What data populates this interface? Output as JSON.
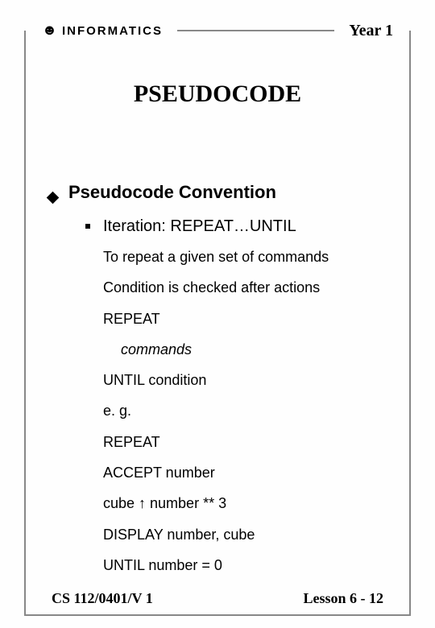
{
  "header": {
    "brand": "INFORMATICS",
    "year": "Year 1"
  },
  "title": "PSEUDOCODE",
  "section": {
    "heading": "Pseudocode Convention",
    "sub": "Iteration: REPEAT…UNTIL",
    "lines": {
      "l0": "To repeat a given set of commands",
      "l1": "Condition is checked after actions",
      "l2": "REPEAT",
      "l3": "commands",
      "l4": "UNTIL condition",
      "l5": "e. g.",
      "l6": "REPEAT",
      "l7": "ACCEPT number",
      "l8": "cube ↑ number ** 3",
      "l9": "DISPLAY number, cube",
      "l10": "UNTIL number = 0"
    }
  },
  "footer": {
    "left": "CS 112/0401/V 1",
    "right": "Lesson 6 - 12"
  }
}
